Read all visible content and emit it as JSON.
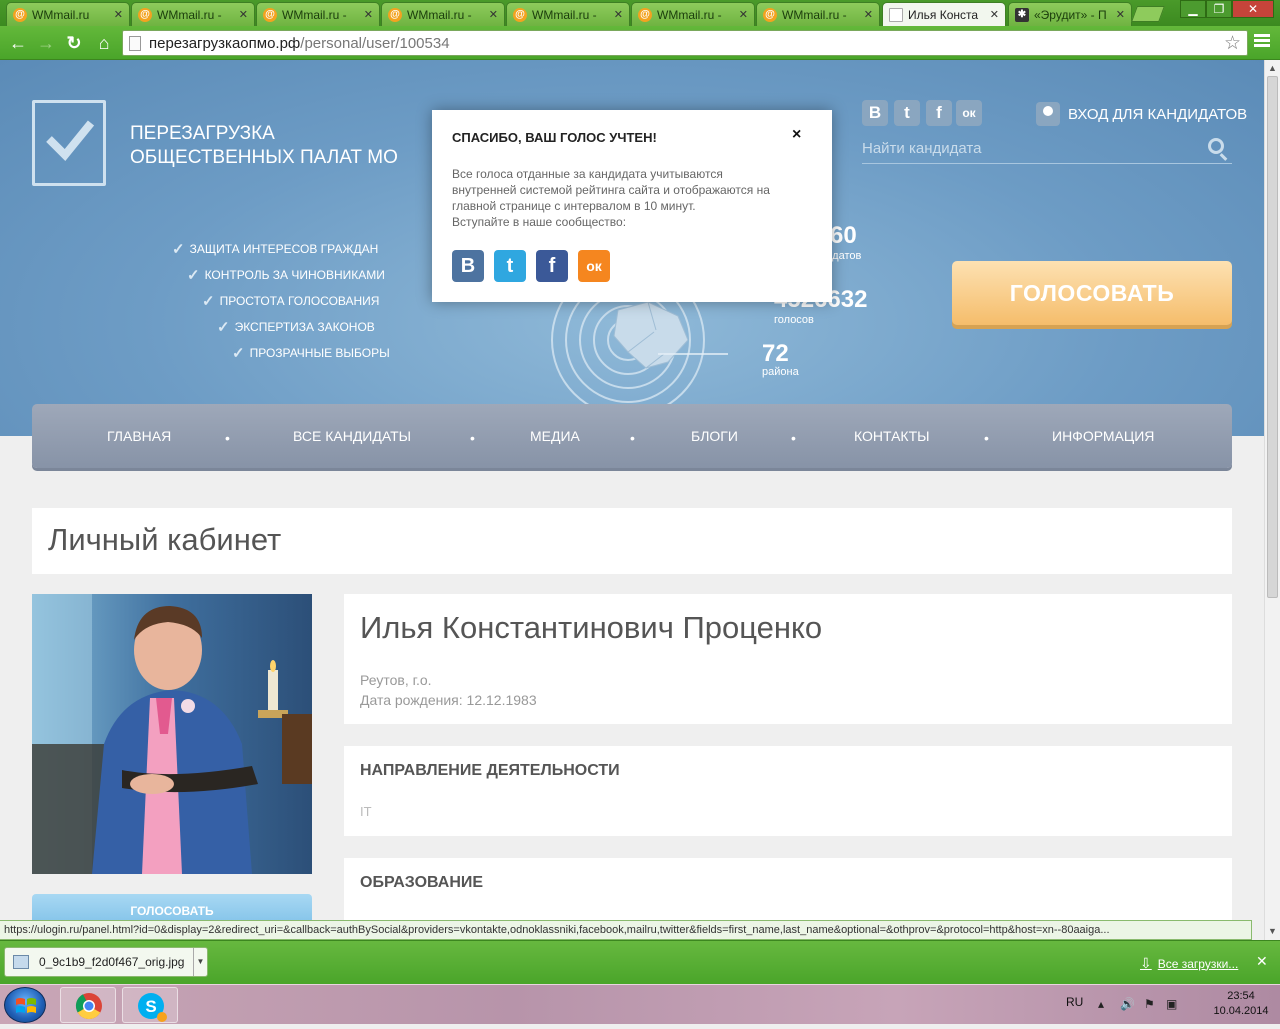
{
  "browser": {
    "tabs": [
      {
        "label": "WMmail.ru",
        "icon": "wmmail-icon",
        "active": false
      },
      {
        "label": "WMmail.ru -",
        "icon": "wmmail-icon",
        "active": false
      },
      {
        "label": "WMmail.ru -",
        "icon": "wmmail-icon",
        "active": false
      },
      {
        "label": "WMmail.ru -",
        "icon": "wmmail-icon",
        "active": false
      },
      {
        "label": "WMmail.ru -",
        "icon": "wmmail-icon",
        "active": false
      },
      {
        "label": "WMmail.ru -",
        "icon": "wmmail-icon",
        "active": false
      },
      {
        "label": "WMmail.ru -",
        "icon": "wmmail-icon",
        "active": false
      },
      {
        "label": "Илья Конста",
        "icon": "page-icon",
        "active": true
      },
      {
        "label": "«Эрудит» - П",
        "icon": "erudit-icon",
        "active": false
      }
    ],
    "url": {
      "host": "перезагрузкаопмо.рф",
      "path": "/personal/user/100534"
    },
    "status_url": "https://ulogin.ru/panel.html?id=0&display=2&redirect_uri=&callback=authBySocial&providers=vkontakte,odnoklassniki,facebook,mailru,twitter&fields=first_name,last_name&optional=&othprov=&protocol=http&host=xn--80aaiga..."
  },
  "site": {
    "title_line1": "ПЕРЕЗАГРУЗКА",
    "title_line2": "ОБЩЕСТВЕННЫХ ПАЛАТ МО",
    "features": [
      "ЗАЩИТА ИНТЕРЕСОВ ГРАЖДАН",
      "КОНТРОЛЬ ЗА ЧИНОВНИКАМИ",
      "ПРОСТОТА ГОЛОСОВАНИЯ",
      "ЭКСПЕРТИЗА ЗАКОНОВ",
      "ПРОЗРАЧНЫЕ ВЫБОРЫ"
    ],
    "stats": [
      {
        "value": "60",
        "label": "идатов"
      },
      {
        "value": "4526632",
        "label": "голосов"
      },
      {
        "value": "72",
        "label": "района"
      }
    ],
    "social": [
      "В",
      "t",
      "f",
      "ок"
    ],
    "login_label": "ВХОД ДЛЯ КАНДИДАТОВ",
    "search_placeholder": "Найти кандидата",
    "vote_button": "ГОЛОСОВАТЬ",
    "nav": [
      "ГЛАВНАЯ",
      "ВСЕ КАНДИДАТЫ",
      "МЕДИА",
      "БЛОГИ",
      "КОНТАКТЫ",
      "ИНФОРМАЦИЯ"
    ],
    "nav_separator": "•"
  },
  "page": {
    "heading": "Личный кабинет",
    "candidate": {
      "name": "Илья Константинович Проценко",
      "city": "Реутов, г.о.",
      "birth": "Дата рождения: 12.12.1983"
    },
    "activity": {
      "title": "НАПРАВЛЕНИЕ ДЕЯТЕЛЬНОСТИ",
      "value": "IT"
    },
    "education": {
      "title": "ОБРАЗОВАНИЕ"
    },
    "vote_small": "ГОЛОСОВАТЬ"
  },
  "modal": {
    "title": "СПАСИБО, ВАШ ГОЛОС УЧТЕН!",
    "close": "×",
    "line1": "Все голоса отданные за кандидата учитываются",
    "line2": "внутренней системой рейтинга сайта и отображаются на",
    "line3": "главной странице с интервалом в 10 минут.",
    "line4": "Вступайте в наше сообщество:",
    "social": [
      {
        "label": "В",
        "color": "#4d73a0"
      },
      {
        "label": "t",
        "color": "#2fa7e0"
      },
      {
        "label": "f",
        "color": "#3b5998"
      },
      {
        "label": "ок",
        "color": "#f5861f"
      }
    ]
  },
  "downloads": {
    "file": "0_9c1b9_f2d0f467_orig.jpg",
    "all_label": "Все загрузки..."
  },
  "taskbar": {
    "lang": "RU",
    "time": "23:54",
    "date": "10.04.2014"
  },
  "colors": {
    "chrome_green": "#4aa52a",
    "hero_blue": "#6d9cc5",
    "vote_orange": "#f5bd6b",
    "nav_gray": "#8793a7"
  }
}
